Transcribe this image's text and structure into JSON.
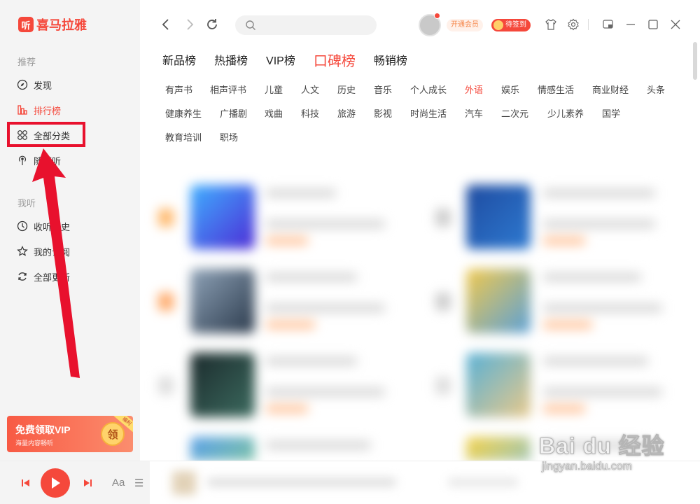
{
  "app": {
    "logo_badge": "听",
    "logo_text": "喜马拉雅"
  },
  "sidebar": {
    "section_recommend": "推荐",
    "items_recommend": [
      {
        "label": "发现",
        "icon": "compass-icon"
      },
      {
        "label": "排行榜",
        "icon": "ranking-icon",
        "active": true
      },
      {
        "label": "全部分类",
        "icon": "grid-icon"
      },
      {
        "label": "随便听",
        "icon": "radio-icon"
      }
    ],
    "section_mine": "我听",
    "items_mine": [
      {
        "label": "收听历史",
        "icon": "clock-icon"
      },
      {
        "label": "我的订阅",
        "icon": "star-icon"
      },
      {
        "label": "全部更新",
        "icon": "refresh-icon"
      }
    ],
    "vip_card": {
      "title": "免费领取VIP",
      "subtitle": "海量内容畅听",
      "coin": "领",
      "tag": "福利"
    }
  },
  "topbar": {
    "search_placeholder": "",
    "vip_button": "开通会员",
    "signin_button": "待签到",
    "icons": [
      "back-icon",
      "forward-icon",
      "refresh-icon",
      "search-icon",
      "shirt-icon",
      "gear-icon",
      "mini-mode-icon",
      "minimize-icon",
      "maximize-icon",
      "close-icon"
    ]
  },
  "tabs": [
    {
      "label": "新品榜"
    },
    {
      "label": "热播榜"
    },
    {
      "label": "VIP榜"
    },
    {
      "label": "口碑榜",
      "active": true
    },
    {
      "label": "畅销榜"
    }
  ],
  "categories": [
    [
      "有声书",
      "相声评书",
      "儿童",
      "人文",
      "历史",
      "音乐",
      "个人成长",
      "外语",
      "娱乐",
      "情感生活",
      "商业财经",
      "头条"
    ],
    [
      "健康养生",
      "广播剧",
      "戏曲",
      "科技",
      "旅游",
      "影视",
      "时尚生活",
      "汽车",
      "二次元",
      "少儿素养",
      "国学"
    ],
    [
      "教育培训",
      "职场"
    ]
  ],
  "active_category": "外语",
  "player": {
    "font_label": "Aa",
    "list_label": "☰"
  },
  "watermark": {
    "main": "Bai du 经验",
    "sub": "jingyan.baidu.com"
  },
  "colors": {
    "accent": "#f5483b",
    "annotation": "#e8112d"
  }
}
